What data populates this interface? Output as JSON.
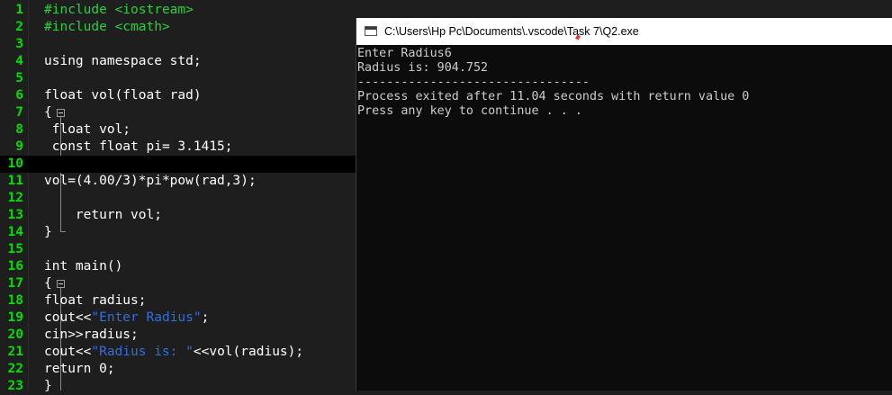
{
  "editor": {
    "lines": [
      {
        "n": "1",
        "segs": [
          {
            "c": "pp",
            "t": "#include <iostream>"
          }
        ]
      },
      {
        "n": "2",
        "segs": [
          {
            "c": "pp",
            "t": "#include <cmath>"
          }
        ]
      },
      {
        "n": "3",
        "segs": []
      },
      {
        "n": "4",
        "segs": [
          {
            "c": "kw",
            "t": "using namespace std;"
          }
        ]
      },
      {
        "n": "5",
        "segs": []
      },
      {
        "n": "6",
        "segs": [
          {
            "c": "kw",
            "t": "float vol(float rad)"
          }
        ]
      },
      {
        "n": "7",
        "segs": [
          {
            "c": "kw",
            "t": "{"
          }
        ]
      },
      {
        "n": "8",
        "segs": [
          {
            "c": "kw",
            "t": " float vol;"
          }
        ]
      },
      {
        "n": "9",
        "segs": [
          {
            "c": "kw",
            "t": " const float pi= 3.1415;"
          }
        ]
      },
      {
        "n": "10",
        "segs": [],
        "current": true
      },
      {
        "n": "11",
        "segs": [
          {
            "c": "kw",
            "t": "vol=(4.00/3)*pi*pow(rad,3);"
          }
        ]
      },
      {
        "n": "12",
        "segs": []
      },
      {
        "n": "13",
        "segs": [
          {
            "c": "kw",
            "t": "    return vol;"
          }
        ]
      },
      {
        "n": "14",
        "segs": [
          {
            "c": "kw",
            "t": "}"
          }
        ]
      },
      {
        "n": "15",
        "segs": []
      },
      {
        "n": "16",
        "segs": [
          {
            "c": "kw",
            "t": "int main()"
          }
        ]
      },
      {
        "n": "17",
        "segs": [
          {
            "c": "kw",
            "t": "{"
          }
        ]
      },
      {
        "n": "18",
        "segs": [
          {
            "c": "kw",
            "t": "float radius;"
          }
        ]
      },
      {
        "n": "19",
        "segs": [
          {
            "c": "kw",
            "t": "cout<<"
          },
          {
            "c": "str",
            "t": "\"Enter Radius\""
          },
          {
            "c": "kw",
            "t": ";"
          }
        ]
      },
      {
        "n": "20",
        "segs": [
          {
            "c": "kw",
            "t": "cin>>radius;"
          }
        ]
      },
      {
        "n": "21",
        "segs": [
          {
            "c": "kw",
            "t": "cout<<"
          },
          {
            "c": "str",
            "t": "\"Radius is: \""
          },
          {
            "c": "kw",
            "t": "<<vol(radius);"
          }
        ]
      },
      {
        "n": "22",
        "segs": [
          {
            "c": "kw",
            "t": "return 0;"
          }
        ]
      },
      {
        "n": "23",
        "segs": [
          {
            "c": "kw",
            "t": "}"
          }
        ]
      }
    ]
  },
  "console": {
    "title": "C:\\Users\\Hp Pc\\Documents\\.vscode\\Task 7\\Q2.exe",
    "output": [
      "Enter Radius6",
      "Radius is: 904.752",
      "--------------------------------",
      "Process exited after 11.04 seconds with return value 0",
      "Press any key to continue . . ."
    ]
  }
}
